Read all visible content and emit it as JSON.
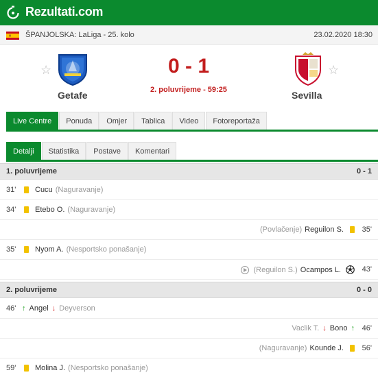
{
  "header": {
    "site_name": "Rezultati.com",
    "logo_icon": "stopwatch-logo-icon",
    "brand_color": "#0b8a2e"
  },
  "match_info": {
    "league": "ŠPANJOLSKA: LaLiga - 25. kolo",
    "datetime": "23.02.2020 18:30"
  },
  "home": {
    "name": "Getafe"
  },
  "away": {
    "name": "Sevilla"
  },
  "score": {
    "text": "0 - 1",
    "status": "2. poluvrijeme - 59:25",
    "color": "#c21d1d"
  },
  "main_tabs": [
    "Live Centre",
    "Ponuda",
    "Omjer",
    "Tablica",
    "Video",
    "Fotoreportaža"
  ],
  "sub_tabs": [
    "Detalji",
    "Statistika",
    "Postave",
    "Komentari"
  ],
  "first_half": {
    "title": "1. poluvrijeme",
    "score": "0 - 1",
    "events": [
      {
        "minute": "31'",
        "player": "Cucu",
        "note": "(Naguravanje)"
      },
      {
        "minute": "34'",
        "player": "Etebo O.",
        "note": "(Naguravanje)"
      },
      {
        "minute": "35'",
        "player": "Reguilon S.",
        "note": "(Povlačenje)"
      },
      {
        "minute": "35'",
        "player": "Nyom A.",
        "note": "(Nesportsko ponašanje)"
      },
      {
        "minute": "43'",
        "player": "Ocampos L.",
        "note": "(Reguilon S.)"
      }
    ]
  },
  "second_half": {
    "title": "2. poluvrijeme",
    "score": "0 - 0",
    "events": [
      {
        "minute": "46'",
        "player_in": "Angel",
        "player_out": "Deyverson"
      },
      {
        "minute": "46'",
        "player_in": "Bono",
        "player_out": "Vaclik T."
      },
      {
        "minute": "56'",
        "player": "Kounde J.",
        "note": "(Naguravanje)"
      },
      {
        "minute": "59'",
        "player": "Molina J.",
        "note": "(Nesportsko ponašanje)"
      }
    ]
  }
}
